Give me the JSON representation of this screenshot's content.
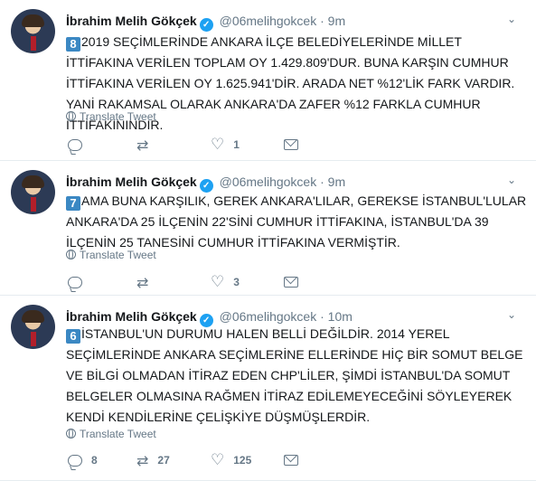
{
  "tweets": [
    {
      "name": "İbrahim Melih Gökçek",
      "handle": "@06melihgokcek",
      "sep": "·",
      "time": "9m",
      "number": "8",
      "text": "2019 SEÇİMLERİNDE ANKARA İLÇE BELEDİYELERİNDE MİLLET İTTİFAKINA VERİLEN TOPLAM OY 1.429.809'DUR. BUNA KARŞIN CUMHUR İTTİFAKINA VERİLEN OY 1.625.941'DİR. ARADA NET %12'LİK FARK VARDIR. YANİ RAKAMSAL OLARAK ANKARA'DA ZAFER %12 FARKLA CUMHUR İTTİFAKININDIR.",
      "translate": "Translate Tweet",
      "replies": "",
      "retweets": "",
      "likes": "1"
    },
    {
      "name": "İbrahim Melih Gökçek",
      "handle": "@06melihgokcek",
      "sep": "·",
      "time": "9m",
      "number": "7",
      "text": "AMA BUNA KARŞILIK, GEREK ANKARA'LILAR, GEREKSE İSTANBUL'LULAR ANKARA'DA 25 İLÇENİN 22'SİNİ CUMHUR İTTİFAKINA, İSTANBUL'DA 39 İLÇENİN 25 TANESİNİ CUMHUR İTTİFAKINA VERMİŞTİR.",
      "translate": "Translate Tweet",
      "replies": "",
      "retweets": "",
      "likes": "3"
    },
    {
      "name": "İbrahim Melih Gökçek",
      "handle": "@06melihgokcek",
      "sep": "·",
      "time": "10m",
      "number": "6",
      "text": "İSTANBUL'UN DURUMU HALEN BELLİ DEĞİLDİR. 2014 YEREL SEÇİMLERİNDE ANKARA SEÇİMLERİNE ELLERİNDE HİÇ BİR SOMUT BELGE VE BİLGİ OLMADAN İTİRAZ EDEN CHP'LİLER, ŞİMDİ İSTANBUL'DA SOMUT BELGELER OLMASINA RAĞMEN İTİRAZ EDİLEMEYECEĞİNİ SÖYLEYEREK KENDİ KENDİLERİNE ÇELİŞKİYE DÜŞMÜŞLERDİR.",
      "translate": "Translate Tweet",
      "replies": "8",
      "retweets": "27",
      "likes": "125"
    }
  ],
  "icons": {
    "verified": "✓",
    "caret": "⌄",
    "retweet": "⇄",
    "like": "♡"
  },
  "colors": {
    "accent": "#1da1f2",
    "number_badge": "#3b88c3",
    "muted": "#657786"
  }
}
